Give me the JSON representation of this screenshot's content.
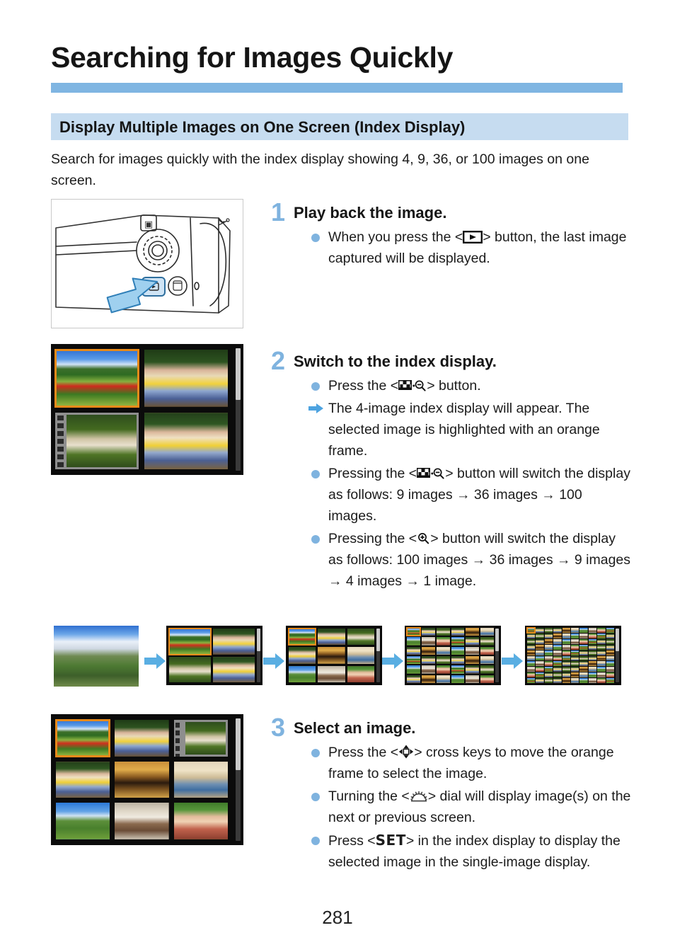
{
  "document": {
    "title": "Searching for Images Quickly",
    "section_heading": "Display Multiple Images on One Screen (Index Display)",
    "intro": "Search for images quickly with the index display showing 4, 9, 36, or 100 images on one screen.",
    "page_number": "281"
  },
  "colors": {
    "title_rule": "#7fb5e2",
    "section_band": "#c6dcf0",
    "step_accent": "#7fb3df",
    "selection_frame": "#e88a1a",
    "arrow_blue": "#4da3e0"
  },
  "steps": [
    {
      "number": "1",
      "title": "Play back the image.",
      "bullets": [
        {
          "marker": "dot",
          "parts": [
            {
              "t": "text",
              "v": "When you press the <"
            },
            {
              "t": "icon",
              "v": "playback-icon"
            },
            {
              "t": "text",
              "v": "> button, the last image captured will be displayed."
            }
          ],
          "plain": "When you press the <playback> button, the last image captured will be displayed."
        }
      ]
    },
    {
      "number": "2",
      "title": "Switch to the index display.",
      "bullets": [
        {
          "marker": "dot",
          "parts": [
            {
              "t": "text",
              "v": "Press the <"
            },
            {
              "t": "icon",
              "v": "index-zoom-out-icon"
            },
            {
              "t": "text",
              "v": "> button."
            }
          ],
          "plain": "Press the <index/zoom-out> button."
        },
        {
          "marker": "arrow",
          "parts": [
            {
              "t": "text",
              "v": "The 4-image index display will appear. The selected image is highlighted with an orange frame."
            }
          ],
          "plain": "The 4-image index display will appear. The selected image is highlighted with an orange frame."
        },
        {
          "marker": "dot",
          "parts": [
            {
              "t": "text",
              "v": "Pressing the <"
            },
            {
              "t": "icon",
              "v": "index-zoom-out-icon"
            },
            {
              "t": "text",
              "v": "> button will switch the display as follows: 9 images → 36 images → 100 images."
            }
          ],
          "plain": "Pressing the <index/zoom-out> button will switch the display as follows: 9 images -> 36 images -> 100 images."
        },
        {
          "marker": "dot",
          "parts": [
            {
              "t": "text",
              "v": "Pressing the <"
            },
            {
              "t": "icon",
              "v": "magnify-icon"
            },
            {
              "t": "text",
              "v": "> button will switch the display as follows: 100 images → 36 images → 9 images → 4 images → 1 image."
            }
          ],
          "plain": "Pressing the <magnify> button will switch the display as follows: 100 images -> 36 images -> 9 images -> 4 images -> 1 image."
        }
      ]
    },
    {
      "number": "3",
      "title": "Select an image.",
      "bullets": [
        {
          "marker": "dot",
          "parts": [
            {
              "t": "text",
              "v": "Press the <"
            },
            {
              "t": "icon",
              "v": "cross-keys-icon"
            },
            {
              "t": "text",
              "v": "> cross keys to move the orange frame to select the image."
            }
          ],
          "plain": "Press the <cross keys> cross keys to move the orange frame to select the image."
        },
        {
          "marker": "dot",
          "parts": [
            {
              "t": "text",
              "v": "Turning the <"
            },
            {
              "t": "icon",
              "v": "main-dial-icon"
            },
            {
              "t": "text",
              "v": "> dial will display image(s) on the next or previous screen."
            }
          ],
          "plain": "Turning the <main dial> dial will display image(s) on the next or previous screen."
        },
        {
          "marker": "dot",
          "parts": [
            {
              "t": "text",
              "v": "Press <"
            },
            {
              "t": "set",
              "v": "SET"
            },
            {
              "t": "text",
              "v": "> in the index display to display the selected image in the single-image display."
            }
          ],
          "plain": "Press <SET> in the index display to display the selected image in the single-image display."
        }
      ]
    }
  ],
  "figures": {
    "camera": {
      "name": "camera-back-playback-button",
      "caption_hidden": "Camera rear illustration with blue arrow pointing at the playback button"
    },
    "index_4": {
      "name": "index-display-4-images",
      "grid": "2x2",
      "selected_index": 0,
      "thumbnails": [
        {
          "label": "poppy-field",
          "type": "photo",
          "selected": true
        },
        {
          "label": "four-girls-with-dog",
          "type": "photo",
          "selected": false
        },
        {
          "label": "papillon-dog-in-grass",
          "type": "movie",
          "selected": false
        },
        {
          "label": "four-girls-group",
          "type": "photo",
          "selected": false
        }
      ]
    },
    "index_9": {
      "name": "index-display-9-images",
      "grid": "3x3",
      "selected_index": 0,
      "thumbnails": [
        {
          "label": "poppy-field",
          "type": "photo",
          "selected": true
        },
        {
          "label": "four-girls-with-dog",
          "type": "photo",
          "selected": false
        },
        {
          "label": "papillon-dog-in-grass",
          "type": "movie",
          "selected": false
        },
        {
          "label": "four-girls-group",
          "type": "photo",
          "selected": false
        },
        {
          "label": "arched-corridor",
          "type": "photo",
          "selected": false
        },
        {
          "label": "restaurant-interior",
          "type": "photo",
          "selected": false
        },
        {
          "label": "grassland-with-herd",
          "type": "photo",
          "selected": false
        },
        {
          "label": "family-of-three",
          "type": "photo",
          "selected": false
        },
        {
          "label": "smiling-woman-portrait",
          "type": "photo",
          "selected": false
        }
      ]
    },
    "progression": {
      "name": "index-display-progression",
      "steps": [
        {
          "label": "1 image",
          "count": 1,
          "grid": "1x1"
        },
        {
          "label": "4 images",
          "count": 4,
          "grid": "2x2"
        },
        {
          "label": "9 images",
          "count": 9,
          "grid": "3x3"
        },
        {
          "label": "36 images",
          "count": 36,
          "grid": "6x6"
        },
        {
          "label": "100 images",
          "count": 100,
          "grid": "10x10"
        }
      ],
      "separator": "arrow-right-icon"
    }
  }
}
